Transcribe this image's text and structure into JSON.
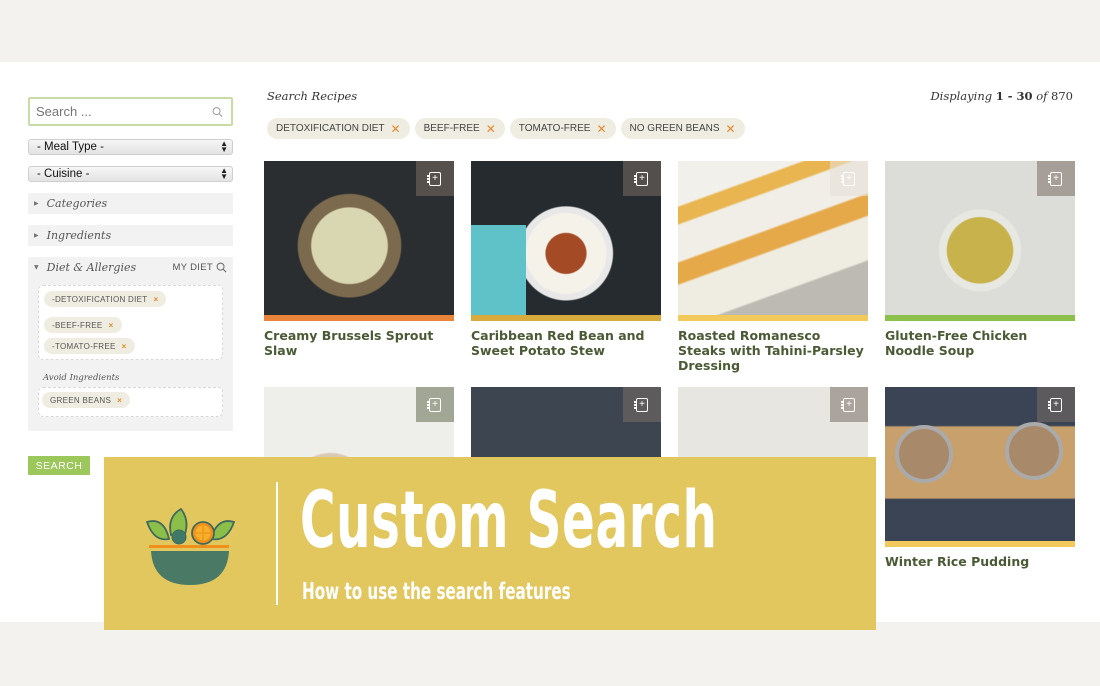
{
  "sidebar": {
    "search_placeholder": "Search ...",
    "meal_type": "- Meal Type -",
    "cuisine": "- Cuisine -",
    "categories_label": "Categories",
    "ingredients_label": "Ingredients",
    "diet_label": "Diet & Allergies",
    "my_diet_label": "MY DIET",
    "diet_tags": [
      {
        "label": "-DETOXIFICATION DIET"
      },
      {
        "label": "-BEEF-FREE"
      },
      {
        "label": "-TOMATO-FREE"
      }
    ],
    "avoid_label": "Avoid Ingredients",
    "avoid_tags": [
      {
        "label": "GREEN BEANS"
      }
    ],
    "search_button": "SEARCH",
    "remove_glyph": "×"
  },
  "main": {
    "title": "Search Recipes",
    "displaying_prefix": "Displaying",
    "range": "1 - 30",
    "of_label": "of",
    "total": "870",
    "filters": [
      {
        "label": "DETOXIFICATION DIET"
      },
      {
        "label": "BEEF-FREE"
      },
      {
        "label": "TOMATO-FREE"
      },
      {
        "label": "NO GREEN BEANS"
      }
    ],
    "remove_glyph": "✕",
    "recipes": [
      {
        "title": "Creamy Brussels Sprout Slaw",
        "accent": "#e8853a"
      },
      {
        "title": "Caribbean Red Bean and Sweet Potato Stew",
        "accent": "#d8aa3c"
      },
      {
        "title": "Roasted Romanesco Steaks with Tahini-Parsley Dressing",
        "accent": "#f2c95a"
      },
      {
        "title": "Gluten-Free Chicken Noodle Soup",
        "accent": "#8cc04a"
      },
      {
        "title": "",
        "accent": ""
      },
      {
        "title": "",
        "accent": ""
      },
      {
        "title": "",
        "accent": ""
      },
      {
        "title": "Winter Rice Pudding",
        "accent": "#f2c95a"
      }
    ]
  },
  "banner": {
    "title": "Custom Search",
    "subtitle": "How to use the search features",
    "background": "#e2c75f"
  }
}
